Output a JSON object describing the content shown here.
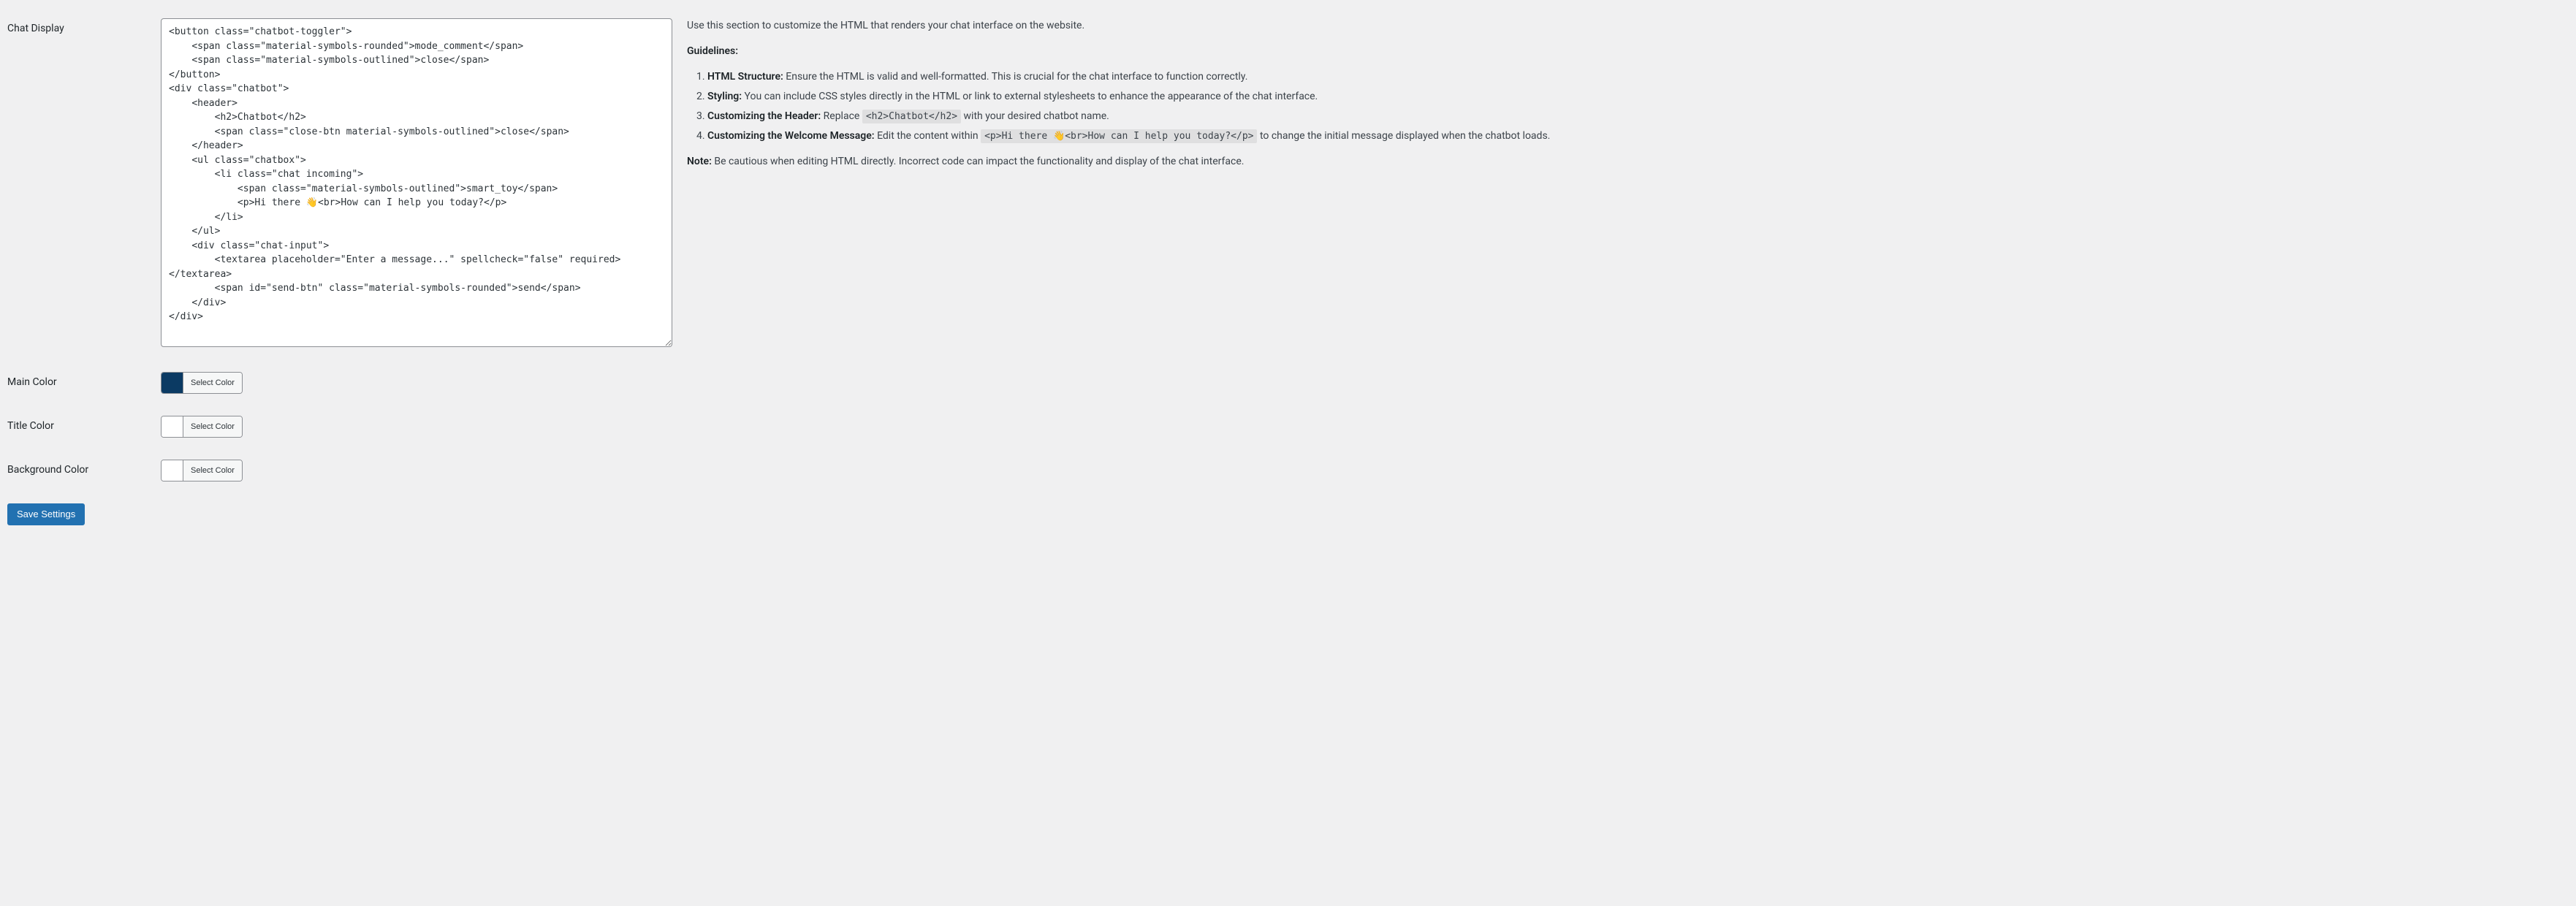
{
  "fields": {
    "chat_display": {
      "label": "Chat Display",
      "value": "<button class=\"chatbot-toggler\">\n    <span class=\"material-symbols-rounded\">mode_comment</span>\n    <span class=\"material-symbols-outlined\">close</span>\n</button>\n<div class=\"chatbot\">\n    <header>\n        <h2>Chatbot</h2>\n        <span class=\"close-btn material-symbols-outlined\">close</span>\n    </header>\n    <ul class=\"chatbox\">\n        <li class=\"chat incoming\">\n            <span class=\"material-symbols-outlined\">smart_toy</span>\n            <p>Hi there 👋<br>How can I help you today?</p>\n        </li>\n    </ul>\n    <div class=\"chat-input\">\n        <textarea placeholder=\"Enter a message...\" spellcheck=\"false\" required></textarea>\n        <span id=\"send-btn\" class=\"material-symbols-rounded\">send</span>\n    </div>\n</div>"
    },
    "main_color": {
      "label": "Main Color",
      "swatch": "#0b3a63",
      "button": "Select Color"
    },
    "title_color": {
      "label": "Title Color",
      "swatch": "",
      "button": "Select Color"
    },
    "background_color": {
      "label": "Background Color",
      "swatch": "",
      "button": "Select Color"
    }
  },
  "help": {
    "intro": "Use this section to customize the HTML that renders your chat interface on the website.",
    "guidelines_label": "Guidelines:",
    "items": [
      {
        "strong": "HTML Structure:",
        "text": " Ensure the HTML is valid and well-formatted. This is crucial for the chat interface to function correctly."
      },
      {
        "strong": "Styling:",
        "text": " You can include CSS styles directly in the HTML or link to external stylesheets to enhance the appearance of the chat interface."
      },
      {
        "strong": "Customizing the Header:",
        "text_before": " Replace ",
        "code": "<h2>Chatbot</h2>",
        "text_after": " with your desired chatbot name."
      },
      {
        "strong": "Customizing the Welcome Message:",
        "text_before": " Edit the content within ",
        "code": "<p>Hi there 👋<br>How can I help you today?</p>",
        "text_after": " to change the initial message displayed when the chatbot loads."
      }
    ],
    "note_label": "Note:",
    "note_text": " Be cautious when editing HTML directly. Incorrect code can impact the functionality and display of the chat interface."
  },
  "submit": {
    "label": "Save Settings"
  }
}
